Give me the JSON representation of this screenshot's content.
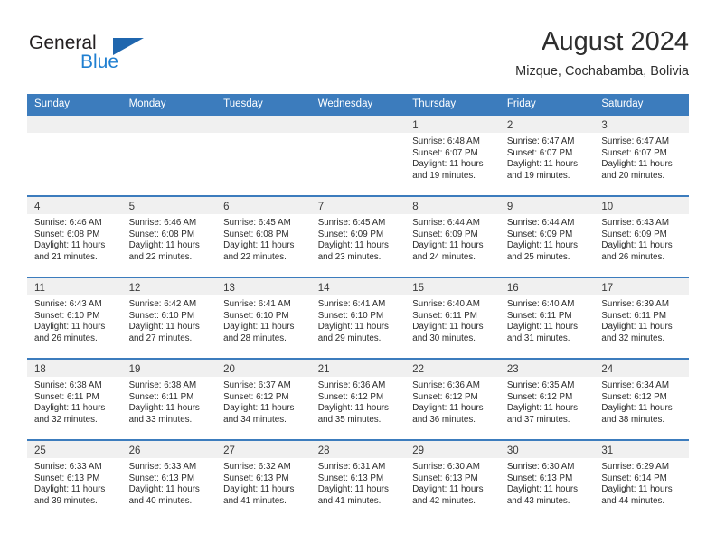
{
  "brand": {
    "name_part1": "General",
    "name_part2": "Blue",
    "color_dark": "#231f20",
    "color_blue": "#1f7fd1"
  },
  "header": {
    "title": "August 2024",
    "subtitle": "Mizque, Cochabamba, Bolivia"
  },
  "theme": {
    "header_blue": "#3c7cbd",
    "band_gray": "#f0f0f0"
  },
  "weekday_headers": [
    "Sunday",
    "Monday",
    "Tuesday",
    "Wednesday",
    "Thursday",
    "Friday",
    "Saturday"
  ],
  "weeks": [
    [
      {
        "day": "",
        "sunrise": "",
        "sunset": "",
        "daylight_1": "",
        "daylight_2": "",
        "empty": true
      },
      {
        "day": "",
        "sunrise": "",
        "sunset": "",
        "daylight_1": "",
        "daylight_2": "",
        "empty": true
      },
      {
        "day": "",
        "sunrise": "",
        "sunset": "",
        "daylight_1": "",
        "daylight_2": "",
        "empty": true
      },
      {
        "day": "",
        "sunrise": "",
        "sunset": "",
        "daylight_1": "",
        "daylight_2": "",
        "empty": true
      },
      {
        "day": "1",
        "sunrise": "Sunrise: 6:48 AM",
        "sunset": "Sunset: 6:07 PM",
        "daylight_1": "Daylight: 11 hours",
        "daylight_2": "and 19 minutes.",
        "empty": false
      },
      {
        "day": "2",
        "sunrise": "Sunrise: 6:47 AM",
        "sunset": "Sunset: 6:07 PM",
        "daylight_1": "Daylight: 11 hours",
        "daylight_2": "and 19 minutes.",
        "empty": false
      },
      {
        "day": "3",
        "sunrise": "Sunrise: 6:47 AM",
        "sunset": "Sunset: 6:07 PM",
        "daylight_1": "Daylight: 11 hours",
        "daylight_2": "and 20 minutes.",
        "empty": false
      }
    ],
    [
      {
        "day": "4",
        "sunrise": "Sunrise: 6:46 AM",
        "sunset": "Sunset: 6:08 PM",
        "daylight_1": "Daylight: 11 hours",
        "daylight_2": "and 21 minutes.",
        "empty": false
      },
      {
        "day": "5",
        "sunrise": "Sunrise: 6:46 AM",
        "sunset": "Sunset: 6:08 PM",
        "daylight_1": "Daylight: 11 hours",
        "daylight_2": "and 22 minutes.",
        "empty": false
      },
      {
        "day": "6",
        "sunrise": "Sunrise: 6:45 AM",
        "sunset": "Sunset: 6:08 PM",
        "daylight_1": "Daylight: 11 hours",
        "daylight_2": "and 22 minutes.",
        "empty": false
      },
      {
        "day": "7",
        "sunrise": "Sunrise: 6:45 AM",
        "sunset": "Sunset: 6:09 PM",
        "daylight_1": "Daylight: 11 hours",
        "daylight_2": "and 23 minutes.",
        "empty": false
      },
      {
        "day": "8",
        "sunrise": "Sunrise: 6:44 AM",
        "sunset": "Sunset: 6:09 PM",
        "daylight_1": "Daylight: 11 hours",
        "daylight_2": "and 24 minutes.",
        "empty": false
      },
      {
        "day": "9",
        "sunrise": "Sunrise: 6:44 AM",
        "sunset": "Sunset: 6:09 PM",
        "daylight_1": "Daylight: 11 hours",
        "daylight_2": "and 25 minutes.",
        "empty": false
      },
      {
        "day": "10",
        "sunrise": "Sunrise: 6:43 AM",
        "sunset": "Sunset: 6:09 PM",
        "daylight_1": "Daylight: 11 hours",
        "daylight_2": "and 26 minutes.",
        "empty": false
      }
    ],
    [
      {
        "day": "11",
        "sunrise": "Sunrise: 6:43 AM",
        "sunset": "Sunset: 6:10 PM",
        "daylight_1": "Daylight: 11 hours",
        "daylight_2": "and 26 minutes.",
        "empty": false
      },
      {
        "day": "12",
        "sunrise": "Sunrise: 6:42 AM",
        "sunset": "Sunset: 6:10 PM",
        "daylight_1": "Daylight: 11 hours",
        "daylight_2": "and 27 minutes.",
        "empty": false
      },
      {
        "day": "13",
        "sunrise": "Sunrise: 6:41 AM",
        "sunset": "Sunset: 6:10 PM",
        "daylight_1": "Daylight: 11 hours",
        "daylight_2": "and 28 minutes.",
        "empty": false
      },
      {
        "day": "14",
        "sunrise": "Sunrise: 6:41 AM",
        "sunset": "Sunset: 6:10 PM",
        "daylight_1": "Daylight: 11 hours",
        "daylight_2": "and 29 minutes.",
        "empty": false
      },
      {
        "day": "15",
        "sunrise": "Sunrise: 6:40 AM",
        "sunset": "Sunset: 6:11 PM",
        "daylight_1": "Daylight: 11 hours",
        "daylight_2": "and 30 minutes.",
        "empty": false
      },
      {
        "day": "16",
        "sunrise": "Sunrise: 6:40 AM",
        "sunset": "Sunset: 6:11 PM",
        "daylight_1": "Daylight: 11 hours",
        "daylight_2": "and 31 minutes.",
        "empty": false
      },
      {
        "day": "17",
        "sunrise": "Sunrise: 6:39 AM",
        "sunset": "Sunset: 6:11 PM",
        "daylight_1": "Daylight: 11 hours",
        "daylight_2": "and 32 minutes.",
        "empty": false
      }
    ],
    [
      {
        "day": "18",
        "sunrise": "Sunrise: 6:38 AM",
        "sunset": "Sunset: 6:11 PM",
        "daylight_1": "Daylight: 11 hours",
        "daylight_2": "and 32 minutes.",
        "empty": false
      },
      {
        "day": "19",
        "sunrise": "Sunrise: 6:38 AM",
        "sunset": "Sunset: 6:11 PM",
        "daylight_1": "Daylight: 11 hours",
        "daylight_2": "and 33 minutes.",
        "empty": false
      },
      {
        "day": "20",
        "sunrise": "Sunrise: 6:37 AM",
        "sunset": "Sunset: 6:12 PM",
        "daylight_1": "Daylight: 11 hours",
        "daylight_2": "and 34 minutes.",
        "empty": false
      },
      {
        "day": "21",
        "sunrise": "Sunrise: 6:36 AM",
        "sunset": "Sunset: 6:12 PM",
        "daylight_1": "Daylight: 11 hours",
        "daylight_2": "and 35 minutes.",
        "empty": false
      },
      {
        "day": "22",
        "sunrise": "Sunrise: 6:36 AM",
        "sunset": "Sunset: 6:12 PM",
        "daylight_1": "Daylight: 11 hours",
        "daylight_2": "and 36 minutes.",
        "empty": false
      },
      {
        "day": "23",
        "sunrise": "Sunrise: 6:35 AM",
        "sunset": "Sunset: 6:12 PM",
        "daylight_1": "Daylight: 11 hours",
        "daylight_2": "and 37 minutes.",
        "empty": false
      },
      {
        "day": "24",
        "sunrise": "Sunrise: 6:34 AM",
        "sunset": "Sunset: 6:12 PM",
        "daylight_1": "Daylight: 11 hours",
        "daylight_2": "and 38 minutes.",
        "empty": false
      }
    ],
    [
      {
        "day": "25",
        "sunrise": "Sunrise: 6:33 AM",
        "sunset": "Sunset: 6:13 PM",
        "daylight_1": "Daylight: 11 hours",
        "daylight_2": "and 39 minutes.",
        "empty": false
      },
      {
        "day": "26",
        "sunrise": "Sunrise: 6:33 AM",
        "sunset": "Sunset: 6:13 PM",
        "daylight_1": "Daylight: 11 hours",
        "daylight_2": "and 40 minutes.",
        "empty": false
      },
      {
        "day": "27",
        "sunrise": "Sunrise: 6:32 AM",
        "sunset": "Sunset: 6:13 PM",
        "daylight_1": "Daylight: 11 hours",
        "daylight_2": "and 41 minutes.",
        "empty": false
      },
      {
        "day": "28",
        "sunrise": "Sunrise: 6:31 AM",
        "sunset": "Sunset: 6:13 PM",
        "daylight_1": "Daylight: 11 hours",
        "daylight_2": "and 41 minutes.",
        "empty": false
      },
      {
        "day": "29",
        "sunrise": "Sunrise: 6:30 AM",
        "sunset": "Sunset: 6:13 PM",
        "daylight_1": "Daylight: 11 hours",
        "daylight_2": "and 42 minutes.",
        "empty": false
      },
      {
        "day": "30",
        "sunrise": "Sunrise: 6:30 AM",
        "sunset": "Sunset: 6:13 PM",
        "daylight_1": "Daylight: 11 hours",
        "daylight_2": "and 43 minutes.",
        "empty": false
      },
      {
        "day": "31",
        "sunrise": "Sunrise: 6:29 AM",
        "sunset": "Sunset: 6:14 PM",
        "daylight_1": "Daylight: 11 hours",
        "daylight_2": "and 44 minutes.",
        "empty": false
      }
    ]
  ]
}
